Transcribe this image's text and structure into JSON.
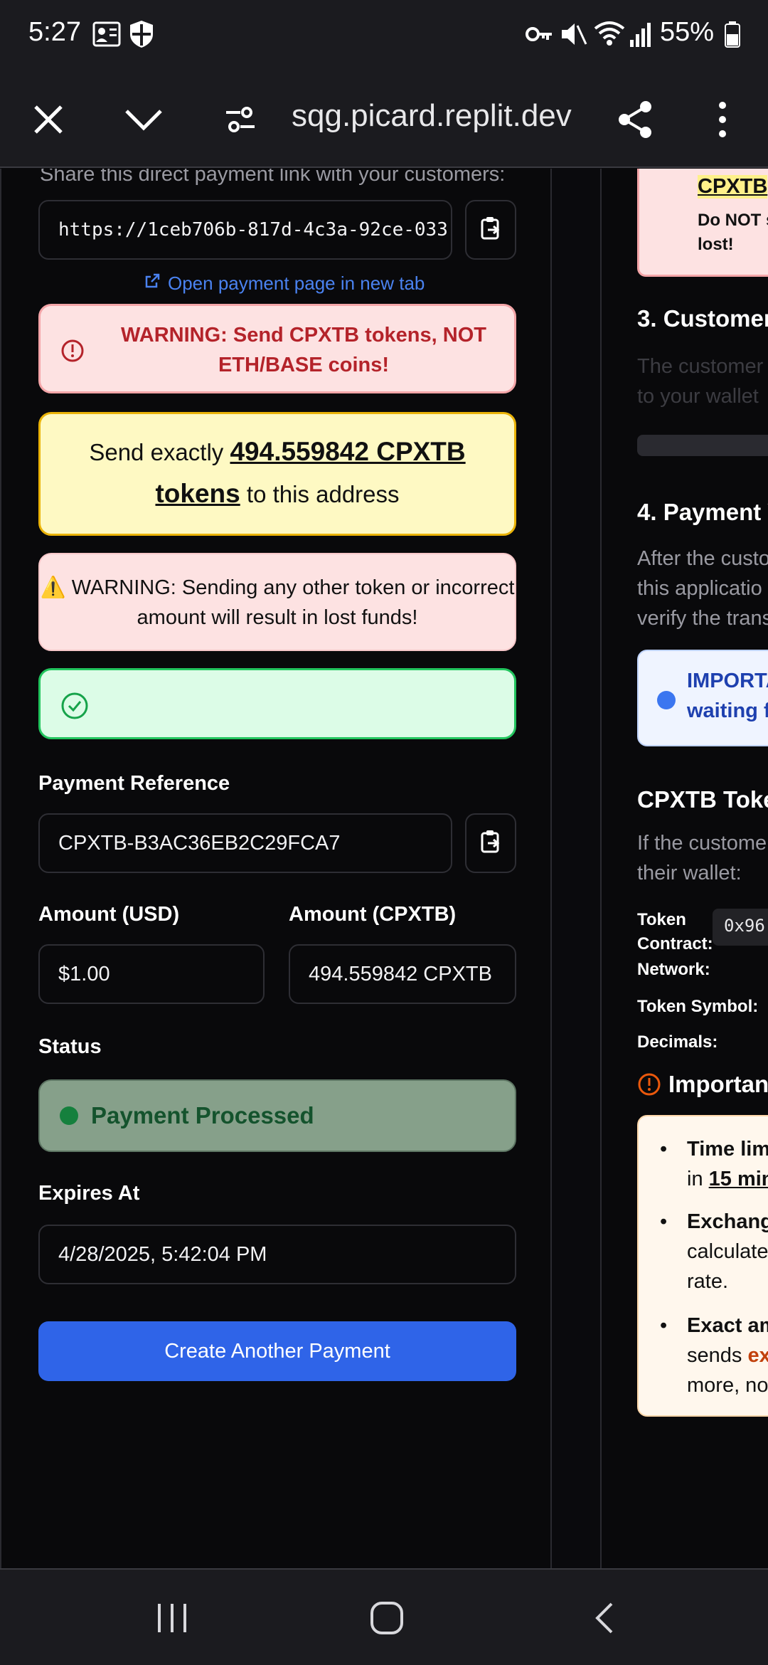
{
  "status_bar": {
    "time": "5:27",
    "battery": "55%"
  },
  "browser": {
    "url": "sqg.picard.replit.dev"
  },
  "payment": {
    "share_text": "Share this direct payment link with your customers:",
    "link_value": "https://1ceb706b-817d-4c3a-92ce-033",
    "open_link": "Open payment page in new tab",
    "warning_red": "WARNING: Send CPXTB tokens, NOT ETH/BASE coins!",
    "send_prefix": "Send exactly ",
    "send_amount": "494.559842 CPXTB tokens",
    "send_suffix": " to this address",
    "warning_pink_icon": "⚠️",
    "warning_pink": " WARNING: Sending any other token or incorrect amount will result in lost funds!",
    "reference_label": "Payment Reference",
    "reference_value": "CPXTB-B3AC36EB2C29FCA7",
    "amount_usd_label": "Amount (USD)",
    "amount_usd_value": "$1.00",
    "amount_cpxtb_label": "Amount (CPXTB)",
    "amount_cpxtb_value": "494.559842 CPXTB",
    "status_label": "Status",
    "status_value": "Payment Processed",
    "expires_label": "Expires At",
    "expires_value": "4/28/2025, 5:42:04 PM",
    "create_button": "Create Another Payment"
  },
  "right_panel": {
    "top_box_title": "CPXTB",
    "top_box_text_1": "Do NOT s",
    "top_box_text_2": "lost!",
    "section3": "3. Customer",
    "section3_text_1": "The customer",
    "section3_text_2": "to your wallet",
    "section4": "4. Payment V",
    "section4_text_1": "After the custo",
    "section4_text_2": "this applicatio",
    "section4_text_3": "verify the trans",
    "important_box_1": "IMPORTA",
    "important_box_2": "waiting f",
    "token_heading": "CPXTB Toke",
    "token_text_1": "If the custome",
    "token_text_2": "their wallet:",
    "token_contract_label_1": "Token",
    "token_contract_label_2": "Contract:",
    "token_contract_value": "0x96",
    "network_label": "Network:",
    "symbol_label": "Token Symbol:",
    "decimals_label": "Decimals:",
    "important_heading": "Important",
    "bullet1_bold": "Time lim",
    "bullet1_line2_prefix": "in ",
    "bullet1_line2_underline": "15 min",
    "bullet2_bold": "Exchang",
    "bullet2_line2": "calculate",
    "bullet2_line3": "rate.",
    "bullet3_bold": "Exact am",
    "bullet3_line2_prefix": "sends ",
    "bullet3_line2_em": "ex",
    "bullet3_line3": "more, no"
  },
  "colors": {
    "accent": "#2f64e8",
    "warning_red": "#b4232a",
    "success": "#22c55e",
    "yellow_border": "#eab308"
  }
}
